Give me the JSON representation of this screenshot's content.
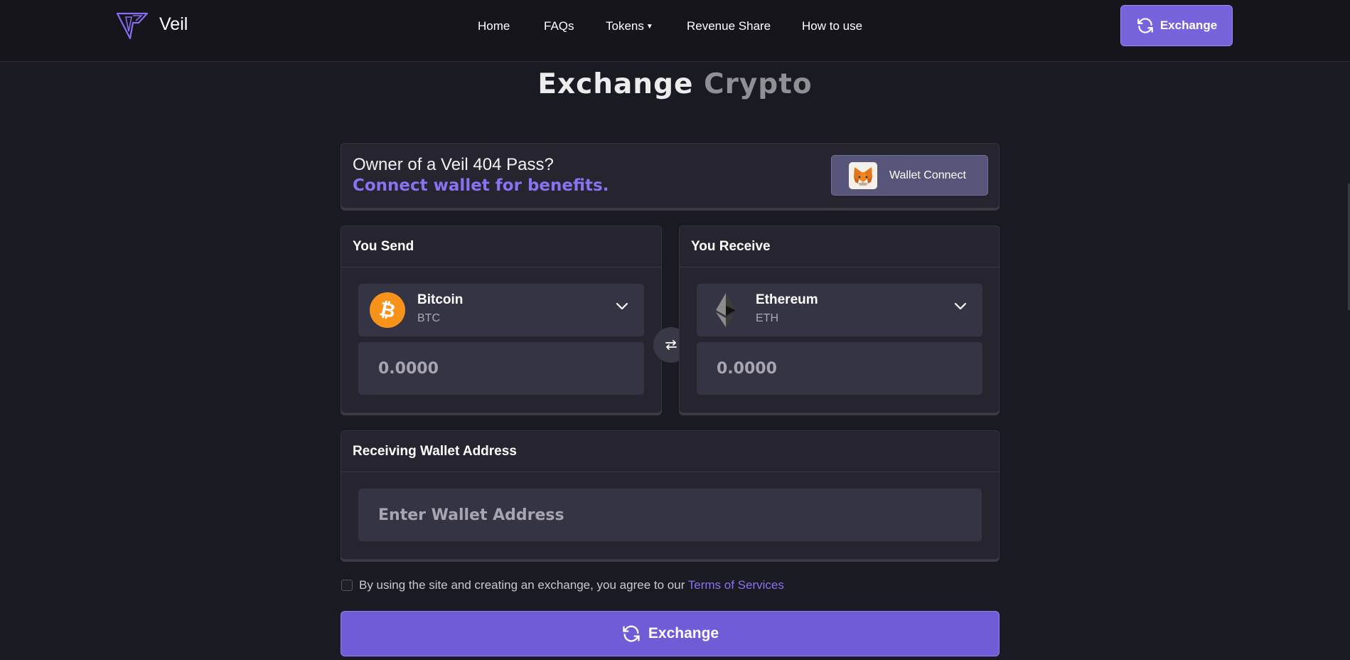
{
  "header": {
    "brand": "Veil",
    "nav": [
      {
        "label": "Home"
      },
      {
        "label": "FAQs"
      },
      {
        "label": "Tokens"
      },
      {
        "label": "Revenue Share"
      },
      {
        "label": "How to use"
      }
    ],
    "exchange_button": "Exchange"
  },
  "title": {
    "word1": "Exchange",
    "word2": "Crypto"
  },
  "pass_card": {
    "line1": "Owner of a Veil 404 Pass?",
    "line2": "Connect wallet for benefits.",
    "wallet_button": "Wallet Connect"
  },
  "send": {
    "heading": "You Send",
    "coin_name": "Bitcoin",
    "coin_symbol": "BTC",
    "amount_placeholder": "0.0000"
  },
  "receive": {
    "heading": "You Receive",
    "coin_name": "Ethereum",
    "coin_symbol": "ETH",
    "amount_placeholder": "0.0000"
  },
  "wallet_address": {
    "heading": "Receiving Wallet Address",
    "placeholder": "Enter Wallet Address"
  },
  "terms": {
    "text": "By using the site and creating an exchange, you agree to our ",
    "link": "Terms of Services"
  },
  "exchange_button": "Exchange",
  "colors": {
    "accent": "#7763db",
    "link": "#8a72f0",
    "background": "#1a1a22",
    "card": "#26252f",
    "bitcoin": "#f7931a"
  }
}
